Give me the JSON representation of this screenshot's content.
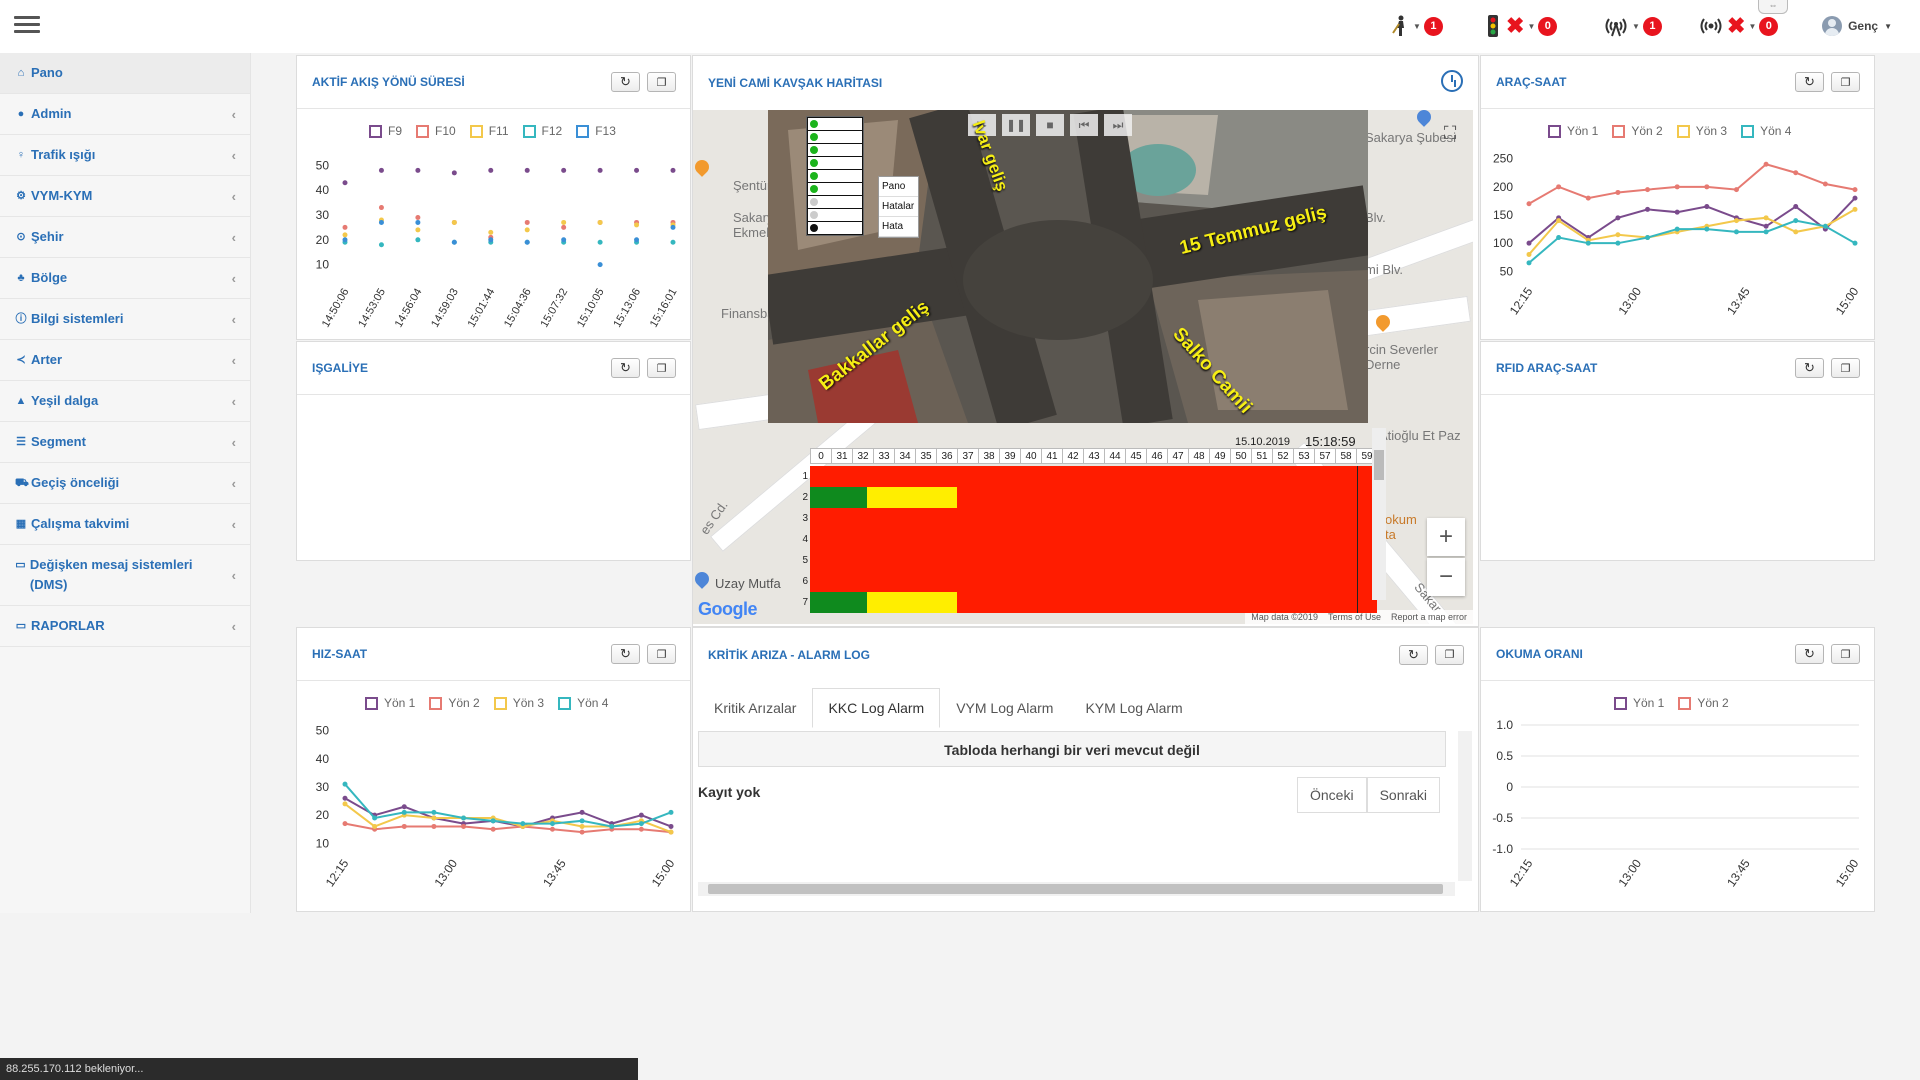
{
  "topbar": {
    "items": [
      {
        "icon": "traffic-man-icon",
        "badge": "1"
      },
      {
        "icon": "traffic-light-icon",
        "badge": "0"
      },
      {
        "icon": "antenna-icon",
        "badge": "1"
      },
      {
        "icon": "wireless-icon",
        "badge": "0"
      }
    ],
    "user_name": "Genç"
  },
  "sidebar": {
    "items": [
      {
        "label": "Pano",
        "icon": "home-icon"
      },
      {
        "label": "Admin",
        "icon": "user-icon"
      },
      {
        "label": "Trafik ışığı",
        "icon": "lightbulb-icon"
      },
      {
        "label": "VYM-KYM",
        "icon": "gear-icon"
      },
      {
        "label": "Şehir",
        "icon": "circle-dot-icon"
      },
      {
        "label": "Bölge",
        "icon": "sitemap-icon"
      },
      {
        "label": "Bilgi sistemleri",
        "icon": "info-icon"
      },
      {
        "label": "Arter",
        "icon": "share-icon"
      },
      {
        "label": "Yeşil dalga",
        "icon": "road-icon"
      },
      {
        "label": "Segment",
        "icon": "list-icon"
      },
      {
        "label": "Geçiş önceliği",
        "icon": "ambulance-icon"
      },
      {
        "label": "Çalışma takvimi",
        "icon": "calendar-icon"
      },
      {
        "label": "Değişken mesaj sistemleri (DMS)",
        "icon": "folder-icon"
      },
      {
        "label": "RAPORLAR",
        "icon": "folder-icon"
      }
    ]
  },
  "panels": {
    "aktif": "AKTİF AKIŞ YÖNÜ SÜRESİ",
    "isgaliye": "IŞGALİYE",
    "hiz": "HIZ-SAAT",
    "harita": "YENİ CAMİ KAVŞAK HARİTASI",
    "kritik": "KRİTİK ARIZA - ALARM LOG",
    "arac": "ARAÇ-SAAT",
    "rfid": "RFID ARAÇ-SAAT",
    "okuma": "OKUMA ORANI"
  },
  "map": {
    "labels": [
      "Şentürk",
      "Sakarya Muha Ekmek",
      "Finansbank ATM",
      "Sakarya Şubesi",
      "mi Blv.",
      "Blv.",
      "rcin Severler Derne",
      "Atioğlu Et Paz",
      "okum ta",
      "Uzay Mutfa",
      "es Cd.",
      "Sakar"
    ],
    "overlay_labels": [
      "lvar geliş",
      "15 Temmuz geliş",
      "Bakkallar geliş",
      "Salko Camii"
    ],
    "menu": [
      "Pano",
      "Hatalar",
      "Hata"
    ],
    "date": "15.10.2019",
    "time": "15:18:59",
    "timeline_ticks": [
      "0",
      "31",
      "32",
      "33",
      "34",
      "35",
      "36",
      "37",
      "38",
      "39",
      "40",
      "41",
      "42",
      "43",
      "44",
      "45",
      "46",
      "47",
      "48",
      "49",
      "50",
      "51",
      "52",
      "53",
      "57",
      "58",
      "59"
    ],
    "timeline_rows": [
      {
        "label": "1",
        "segments": [
          {
            "color": "#ff1c00",
            "frac": 1
          }
        ]
      },
      {
        "label": "2",
        "segments": [
          {
            "color": "#0f8a1e",
            "frac": 0.1
          },
          {
            "color": "#ffee00",
            "frac": 0.16
          },
          {
            "color": "#ff1c00",
            "frac": 0.74
          }
        ]
      },
      {
        "label": "3",
        "segments": [
          {
            "color": "#ff1c00",
            "frac": 1
          }
        ]
      },
      {
        "label": "4",
        "segments": [
          {
            "color": "#ff1c00",
            "frac": 1
          }
        ]
      },
      {
        "label": "5",
        "segments": [
          {
            "color": "#ff1c00",
            "frac": 1
          }
        ]
      },
      {
        "label": "6",
        "segments": [
          {
            "color": "#ff1c00",
            "frac": 1
          }
        ]
      },
      {
        "label": "7",
        "segments": [
          {
            "color": "#0f8a1e",
            "frac": 0.1
          },
          {
            "color": "#ffee00",
            "frac": 0.16
          },
          {
            "color": "#ff1c00",
            "frac": 0.74
          }
        ]
      }
    ],
    "google": "Google",
    "footer": [
      "Map data ©2019",
      "Terms of Use",
      "Report a map error"
    ]
  },
  "kritik": {
    "tabs": [
      "Kritik Arızalar",
      "KKC Log Alarm",
      "VYM Log Alarm",
      "KYM Log Alarm"
    ],
    "active_tab": 1,
    "empty": "Tabloda herhangi bir veri mevcut değil",
    "record": "Kayıt yok",
    "prev": "Önceki",
    "next": "Sonraki"
  },
  "status_bar": "88.255.170.112 bekleniyor...",
  "colors": {
    "purple": "#7a4b8c",
    "red": "#e67a72",
    "yellow": "#f3c84b",
    "teal": "#35b7bf",
    "blue": "#3a8fd6"
  },
  "chart_data": [
    {
      "id": "aktif",
      "type": "scatter",
      "categories": [
        "14:50:06",
        "14:53:05",
        "14:56:04",
        "14:59:03",
        "15:01:44",
        "15:04:36",
        "15:07:32",
        "15:10:05",
        "15:13:06",
        "15:16:01"
      ],
      "series": [
        {
          "name": "F9",
          "color": "#7a4b8c",
          "values": [
            43,
            48,
            48,
            47,
            48,
            48,
            48,
            48,
            48,
            48
          ]
        },
        {
          "name": "F10",
          "color": "#e67a72",
          "values": [
            25,
            33,
            29,
            27,
            21,
            27,
            25,
            27,
            27,
            27
          ]
        },
        {
          "name": "F11",
          "color": "#f3c84b",
          "values": [
            22,
            28,
            24,
            27,
            23,
            24,
            27,
            27,
            26,
            26
          ]
        },
        {
          "name": "F12",
          "color": "#35b7bf",
          "values": [
            19,
            18,
            20,
            19,
            19,
            19,
            19,
            19,
            19,
            19
          ]
        },
        {
          "name": "F13",
          "color": "#3a8fd6",
          "values": [
            20,
            27,
            27,
            19,
            20,
            19,
            20,
            10,
            20,
            25
          ]
        }
      ],
      "yticks": [
        10,
        20,
        30,
        40,
        50
      ],
      "ylim": [
        5,
        55
      ]
    },
    {
      "id": "hiz",
      "type": "line",
      "x": [
        "12:15",
        "13:00",
        "13:45",
        "15:00"
      ],
      "series": [
        {
          "name": "Yön 1",
          "color": "#7a4b8c",
          "values": [
            26,
            20,
            23,
            19,
            17,
            18,
            16,
            19,
            21,
            17,
            20,
            16
          ]
        },
        {
          "name": "Yön 2",
          "color": "#e67a72",
          "values": [
            17,
            15,
            16,
            16,
            16,
            15,
            16,
            15,
            14,
            15,
            15,
            14
          ]
        },
        {
          "name": "Yön 3",
          "color": "#f3c84b",
          "values": [
            24,
            16,
            20,
            19,
            19,
            19,
            16,
            18,
            16,
            16,
            18,
            14
          ]
        },
        {
          "name": "Yön 4",
          "color": "#35b7bf",
          "values": [
            31,
            19,
            21,
            21,
            19,
            18,
            17,
            17,
            18,
            16,
            17,
            21
          ]
        }
      ],
      "yticks": [
        10,
        20,
        30,
        40,
        50
      ],
      "ylim": [
        8,
        52
      ]
    },
    {
      "id": "arac",
      "type": "line",
      "x": [
        "12:15",
        "13:00",
        "13:45",
        "15:00"
      ],
      "series": [
        {
          "name": "Yön 1",
          "color": "#7a4b8c",
          "values": [
            100,
            145,
            110,
            145,
            160,
            155,
            165,
            145,
            130,
            165,
            125,
            180
          ]
        },
        {
          "name": "Yön 2",
          "color": "#e67a72",
          "values": [
            170,
            200,
            180,
            190,
            195,
            200,
            200,
            195,
            240,
            225,
            205,
            195
          ]
        },
        {
          "name": "Yön 3",
          "color": "#f3c84b",
          "values": [
            80,
            140,
            105,
            115,
            110,
            120,
            130,
            140,
            145,
            120,
            130,
            160
          ]
        },
        {
          "name": "Yön 4",
          "color": "#35b7bf",
          "values": [
            65,
            110,
            100,
            100,
            110,
            125,
            125,
            120,
            120,
            140,
            130,
            100
          ]
        }
      ],
      "yticks": [
        50,
        100,
        150,
        200,
        250
      ],
      "ylim": [
        40,
        260
      ]
    },
    {
      "id": "okuma",
      "type": "line",
      "x": [
        "12:15",
        "13:00",
        "13:45",
        "15:00"
      ],
      "series": [
        {
          "name": "Yön 1",
          "color": "#7a4b8c",
          "values": []
        },
        {
          "name": "Yön 2",
          "color": "#e67a72",
          "values": []
        }
      ],
      "ytick_labels": [
        "1.0",
        "0.5",
        "0",
        "-0.5",
        "-1.0"
      ],
      "ylim": [
        -1,
        1
      ]
    }
  ]
}
